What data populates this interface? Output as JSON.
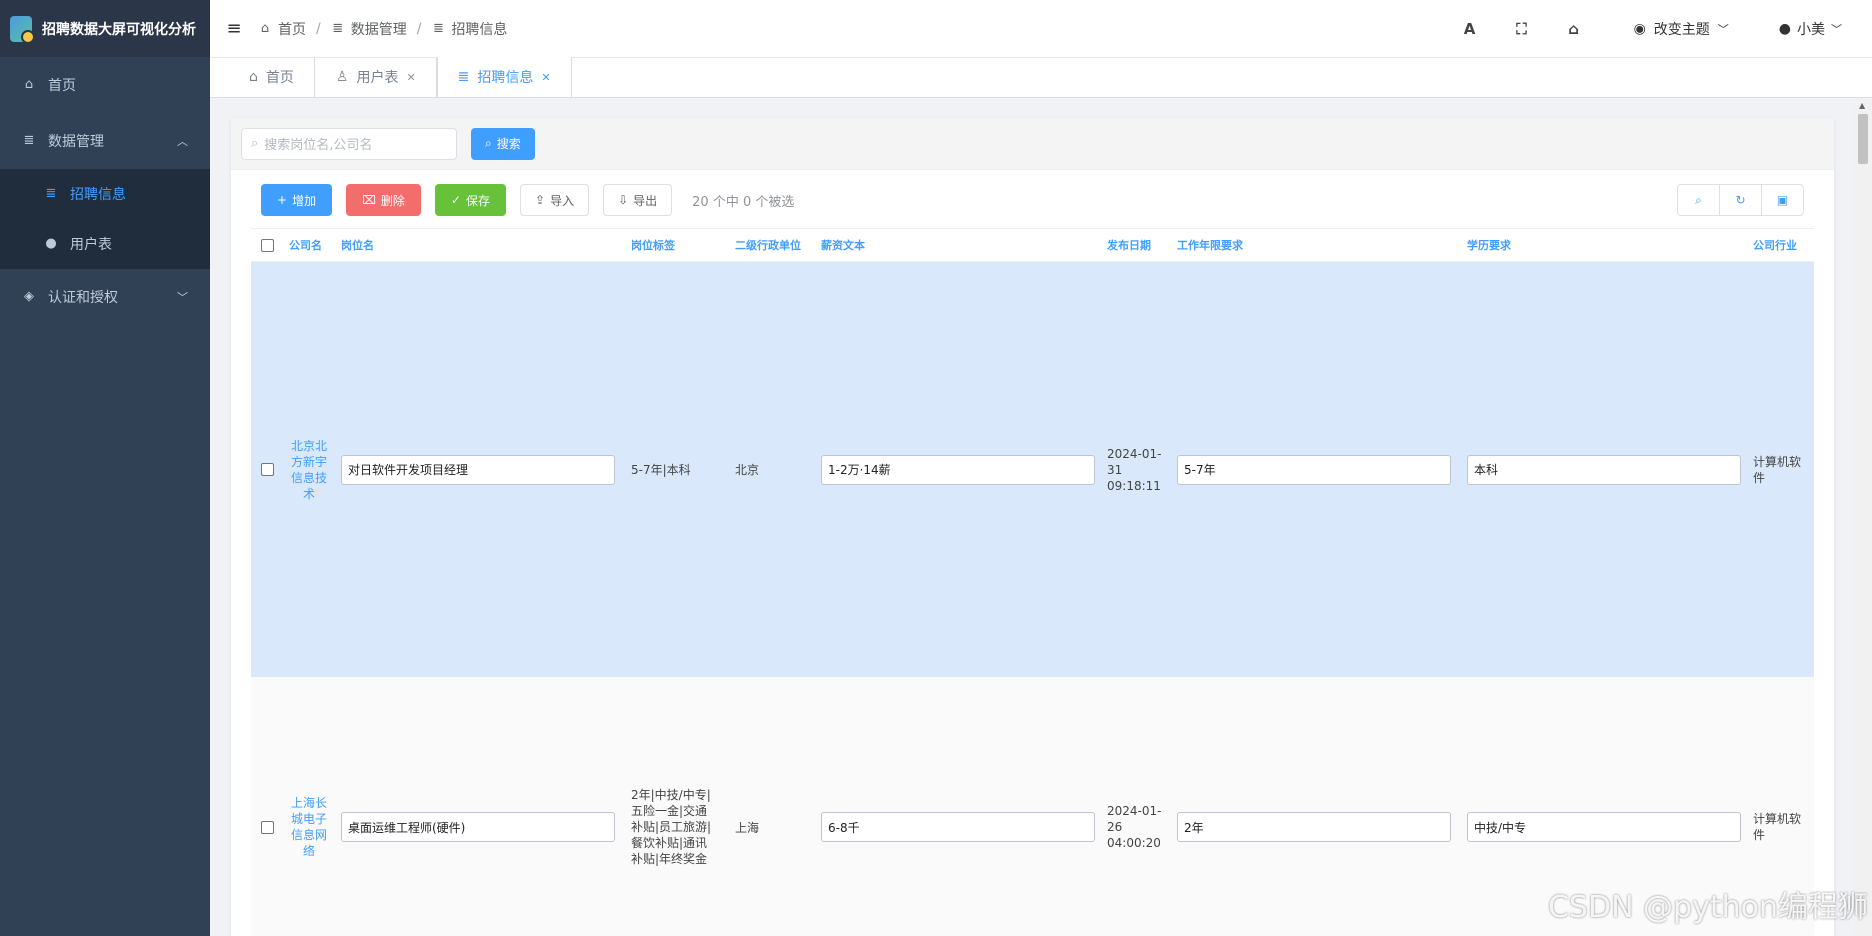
{
  "app": {
    "title": "招聘数据大屏可视化分析"
  },
  "sidebar": {
    "items": [
      {
        "label": "首页",
        "icon": "home-icon"
      },
      {
        "label": "数据管理",
        "icon": "database-icon",
        "expanded": true
      },
      {
        "label": "招聘信息",
        "icon": "database-icon",
        "active": true
      },
      {
        "label": "用户表",
        "icon": "user-icon"
      },
      {
        "label": "认证和授权",
        "icon": "shield-icon"
      }
    ]
  },
  "header": {
    "breadcrumb": [
      "首页",
      "数据管理",
      "招聘信息"
    ],
    "theme_label": "改变主题",
    "user_name": "小美"
  },
  "tags": [
    {
      "label": "首页"
    },
    {
      "label": "用户表"
    },
    {
      "label": "招聘信息",
      "active": true
    }
  ],
  "search": {
    "placeholder": "搜索岗位名,公司名",
    "button_label": "搜索"
  },
  "toolbar": {
    "add_label": "增加",
    "delete_label": "删除",
    "save_label": "保存",
    "import_label": "导入",
    "export_label": "导出",
    "selection_info": "20 个中 0 个被选"
  },
  "table": {
    "columns": [
      "公司名",
      "岗位名",
      "岗位标签",
      "二级行政单位",
      "薪资文本",
      "发布日期",
      "工作年限要求",
      "学历要求",
      "公司行业"
    ],
    "rows": [
      {
        "company": "北京北方新宇信息技术",
        "position": "对日软件开发项目经理",
        "tags": "5-7年|本科",
        "area": "北京",
        "salary": "1-2万·14薪",
        "date": "2024-01-31 09:18:11",
        "experience": "5-7年",
        "education": "本科",
        "industry": "计算机软件"
      },
      {
        "company": "上海长城电子信息网络",
        "position": "桌面运维工程师(硬件)",
        "tags": "2年|中技/中专|五险一金|交通补贴|员工旅游|餐饮补贴|通讯补贴|年终奖金",
        "area": "上海",
        "salary": "6-8千",
        "date": "2024-01-26 04:00:20",
        "experience": "2年",
        "education": "中技/中专",
        "industry": "计算机软件"
      }
    ]
  },
  "watermark": "CSDN @python编程狮"
}
